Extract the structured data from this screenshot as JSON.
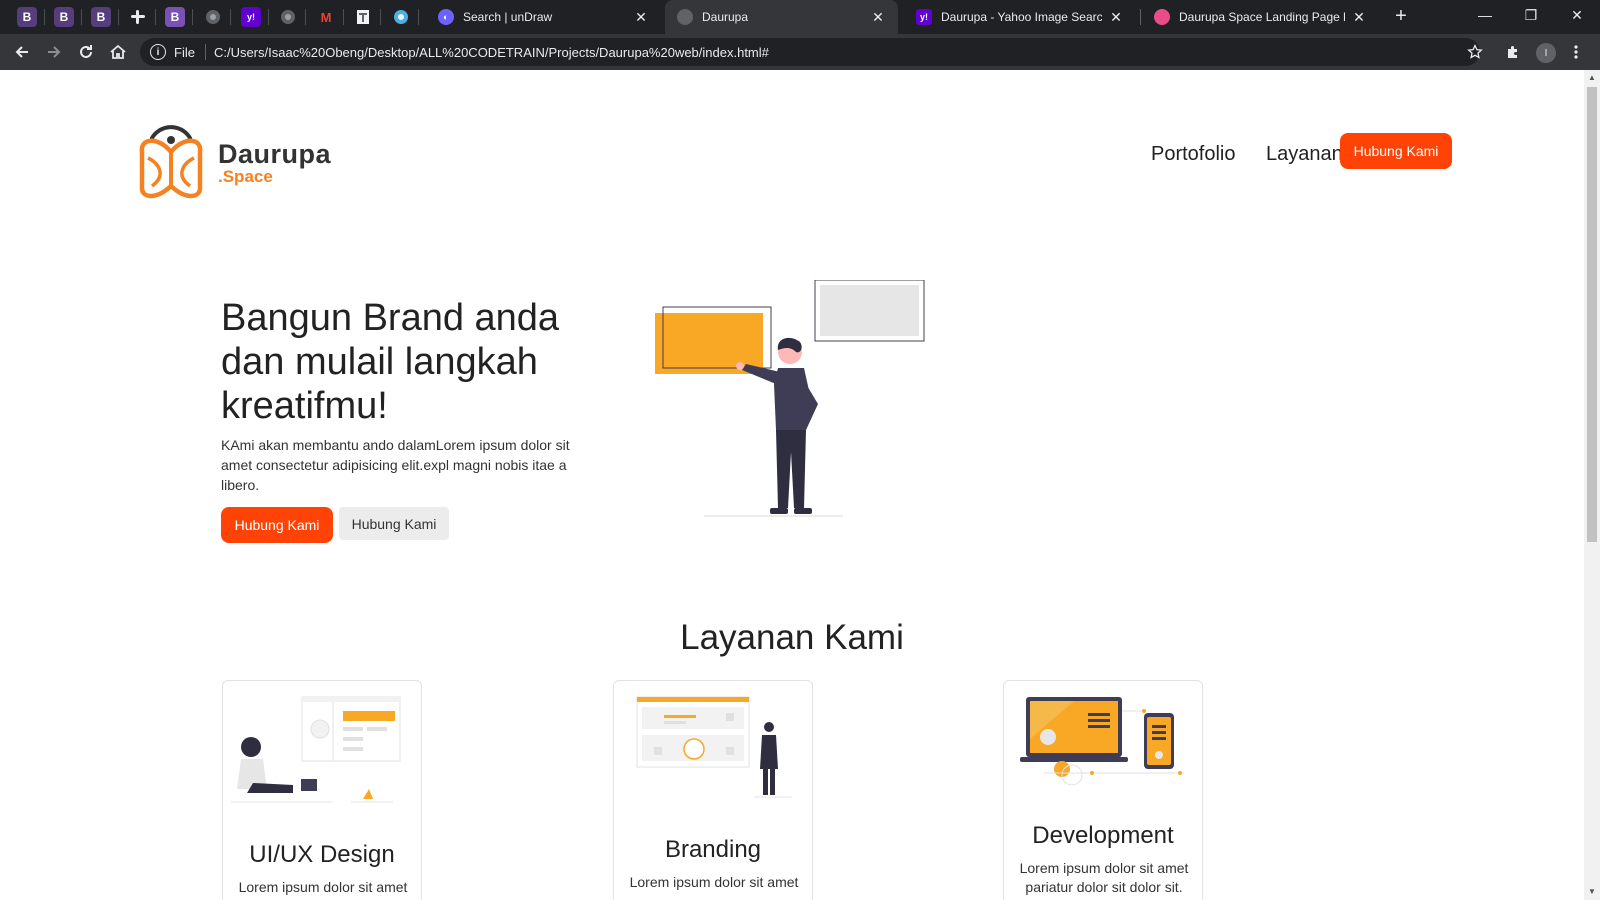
{
  "browser": {
    "pinned_tabs": [
      "B",
      "B",
      "B",
      "",
      "B",
      "",
      "y!",
      "",
      "M",
      "",
      ""
    ],
    "tabs": [
      {
        "title": "Search | unDraw",
        "active": false
      },
      {
        "title": "Daurupa",
        "active": true
      },
      {
        "title": "Daurupa - Yahoo Image Search R",
        "active": false
      },
      {
        "title": "Daurupa Space Landing Page by",
        "active": false
      }
    ],
    "address": {
      "scheme": "File",
      "url": "C:/Users/Isaac%20Obeng/Desktop/ALL%20CODETRAIN/Projects/Daurupa%20web/index.html#"
    },
    "profile_initial": "I"
  },
  "colors": {
    "brand_orange": "#f58220",
    "cta_red": "#ff4306",
    "illustration_yellow": "#f9a826",
    "figure_dark": "#2f2e41"
  },
  "header": {
    "logo_name": "Daurupa",
    "logo_sub": ".Space",
    "nav": [
      "Portofolio",
      "Layanan"
    ],
    "cta": "Hubung Kami"
  },
  "hero": {
    "title": "Bangun Brand anda dan mulail langkah kreatifmu!",
    "description": "KAmi akan membantu ando dalamLorem ipsum dolor sit amet consectetur adipisicing elit.expl magni nobis itae a libero.",
    "primary_button": "Hubung Kami",
    "secondary_button": "Hubung Kami"
  },
  "services": {
    "title": "Layanan Kami",
    "cards": [
      {
        "title": "UI/UX Design",
        "text": "Lorem ipsum dolor sit amet"
      },
      {
        "title": "Branding",
        "text": "Lorem ipsum dolor sit amet"
      },
      {
        "title": "Development",
        "text": "Lorem ipsum dolor sit amet pariatur dolor sit dolor sit."
      }
    ]
  }
}
